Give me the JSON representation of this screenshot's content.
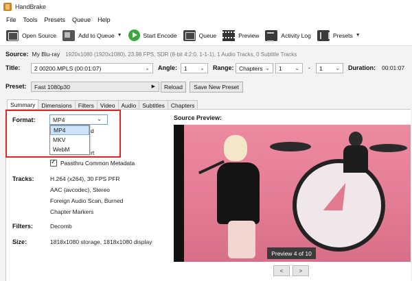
{
  "window": {
    "title": "HandBrake"
  },
  "menu": [
    "File",
    "Tools",
    "Presets",
    "Queue",
    "Help"
  ],
  "toolbar": {
    "open_source": "Open Source",
    "add_to_queue": "Add to Queue",
    "start_encode": "Start Encode",
    "queue": "Queue",
    "preview": "Preview",
    "activity_log": "Activity Log",
    "presets": "Presets"
  },
  "source": {
    "label": "Source:",
    "name": "My Blu-ray",
    "info": "1920x1080 (1920x1080), 23.98 FPS, SDR (8-bit 4:2:0, 1-1-1), 1 Audio Tracks, 0 Subtitle Tracks"
  },
  "title_row": {
    "title_label": "Title:",
    "title_value": "2 00200.MPLS (00:01:07)",
    "angle_label": "Angle:",
    "angle_value": "1",
    "range_label": "Range:",
    "range_mode": "Chapters",
    "range_start": "1",
    "range_sep": "-",
    "range_end": "1",
    "duration_label": "Duration:",
    "duration_value": "00:01:07"
  },
  "preset_row": {
    "label": "Preset:",
    "value": "Fast 1080p30",
    "reload": "Reload",
    "save_new": "Save New Preset"
  },
  "tabs": [
    "Summary",
    "Dimensions",
    "Filters",
    "Video",
    "Audio",
    "Subtitles",
    "Chapters"
  ],
  "summary": {
    "format_label": "Format:",
    "format_value": "MP4",
    "format_options": [
      "MP4",
      "MKV",
      "WebM"
    ],
    "passthru_label": "Passthru Common Metadata",
    "tracks_label": "Tracks:",
    "tracks": [
      "H.264 (x264), 30 FPS PFR",
      "AAC (avcodec), Stereo",
      "Foreign Audio Scan, Burned",
      "Chapter Markers"
    ],
    "filters_label": "Filters:",
    "filters_value": "Decomb",
    "size_label": "Size:",
    "size_value": "1818x1080 storage, 1818x1080 display"
  },
  "preview": {
    "title": "Source Preview:",
    "pager": "Preview 4 of 10",
    "prev": "<",
    "next": ">"
  },
  "colors": {
    "highlight": "#e02424",
    "play_green": "#3da640",
    "preview_pink": "#e07f92"
  }
}
